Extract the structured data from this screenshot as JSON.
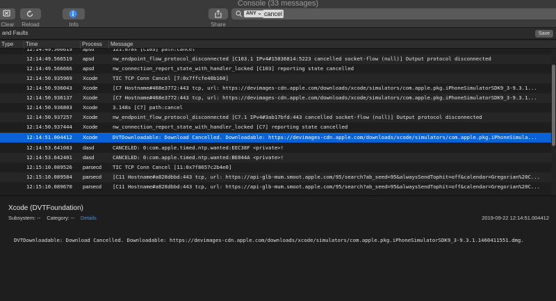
{
  "window": {
    "title": "Console (33 messages)"
  },
  "toolbar": {
    "clear_label": "Clear",
    "reload_label": "Reload",
    "info_label": "Info",
    "share_label": "Share",
    "search": {
      "token": "ANY ⌄",
      "query": "cancel"
    }
  },
  "filterbar": {
    "text": "and Faults",
    "save_label": "Save"
  },
  "columns": {
    "type": "Type",
    "time": "Time",
    "process": "Process",
    "message": "Message"
  },
  "rows": [
    {
      "time": "12:14:49.566619",
      "process": "apsd",
      "message": "121.878s [C103] path:cancel"
    },
    {
      "time": "12:14:49.566519",
      "process": "apsd",
      "message": "nw_endpoint_flow_protocol_disconnected [C103.1 IPv4#15036814:5223 cancelled socket-flow (null)] Output protocol disconnected"
    },
    {
      "time": "12:14:49.566666",
      "process": "apsd",
      "message": "nw_connection_report_state_with_handler_locked [C103] reporting state cancelled"
    },
    {
      "time": "12:14:50.935969",
      "process": "Xcode",
      "message": "TIC TCP Conn Cancel [7:0x7ffcfe40b160]"
    },
    {
      "time": "12:14:50.936043",
      "process": "Xcode",
      "message": "[C7 Hostname#468e3772:443 tcp, url: https://devimages-cdn.apple.com/downloads/xcode/simulators/com.apple.pkg.iPhoneSimulatorSDK9_3-9.3.1..."
    },
    {
      "time": "12:14:50.936137",
      "process": "Xcode",
      "message": "[C7 Hostname#468e3772:443 tcp, url: https://devimages-cdn.apple.com/downloads/xcode/simulators/com.apple.pkg.iPhoneSimulatorSDK9_3-9.3.1..."
    },
    {
      "time": "12:14:50.936803",
      "process": "Xcode",
      "message": "3.148s [C7] path:cancel"
    },
    {
      "time": "12:14:50.937257",
      "process": "Xcode",
      "message": "nw_endpoint_flow_protocol_disconnected [C7.1 IPv4#3ab17bfd:443 cancelled socket-flow (null)] Output protocol disconnected"
    },
    {
      "time": "12:14:50.937444",
      "process": "Xcode",
      "message": "nw_connection_report_state_with_handler_locked [C7] reporting state cancelled"
    },
    {
      "time": "12:14:51.004412",
      "process": "Xcode",
      "message": "DVTDownloadable: Download Cancelled. Downloadable: https://devimages-cdn.apple.com/downloads/xcode/simulators/com.apple.pkg.iPhoneSimula..."
    },
    {
      "time": "12:14:53.641083",
      "process": "dasd",
      "message": "CANCELED: 0:com.apple.timed.ntp.wanted:EEC38F <private>!"
    },
    {
      "time": "12:14:53.642401",
      "process": "dasd",
      "message": "CANCELED: 0:com.apple.timed.ntp.wanted:BE044A <private>!"
    },
    {
      "time": "12:15:10.089526",
      "process": "parsecd",
      "message": "TIC TCP Conn Cancel [11:0x7f8657c2b4e0]"
    },
    {
      "time": "12:15:10.089584",
      "process": "parsecd",
      "message": "[C11 Hostname#a828dbbd:443 tcp, url: https://api-glb-mum.smoot.apple.com/95/search?ab_seed=95&alwaysSendTophit=off&calendar=Gregorian%20C..."
    },
    {
      "time": "12:15:10.089670",
      "process": "parsecd",
      "message": "[C11 Hostname#a828dbbd:443 tcp, url: https://api-glb-mum.smoot.apple.com/95/search?ab_seed=95&alwaysSendTophit=off&calendar=Gregorian%20C..."
    }
  ],
  "selected_index": 9,
  "detail": {
    "title": "Xcode (DVTFoundation)",
    "subsystem_label": "Subsystem: --",
    "category_label": "Category: --",
    "details_link": "Details",
    "date": "2019-09-22 12:14:51.004412",
    "message": "DVTDownloadable: Download Cancelled. Downloadable: https://devimages-cdn.apple.com/downloads/xcode/simulators/com.apple.pkg.iPhoneSimulatorSDK9_3-9.3.1.1460411551.dmg."
  },
  "colors": {
    "selection": "#0a63d6",
    "link": "#4a90e2",
    "toolbar": "#3a3a3a",
    "background": "#1e1e1e"
  }
}
